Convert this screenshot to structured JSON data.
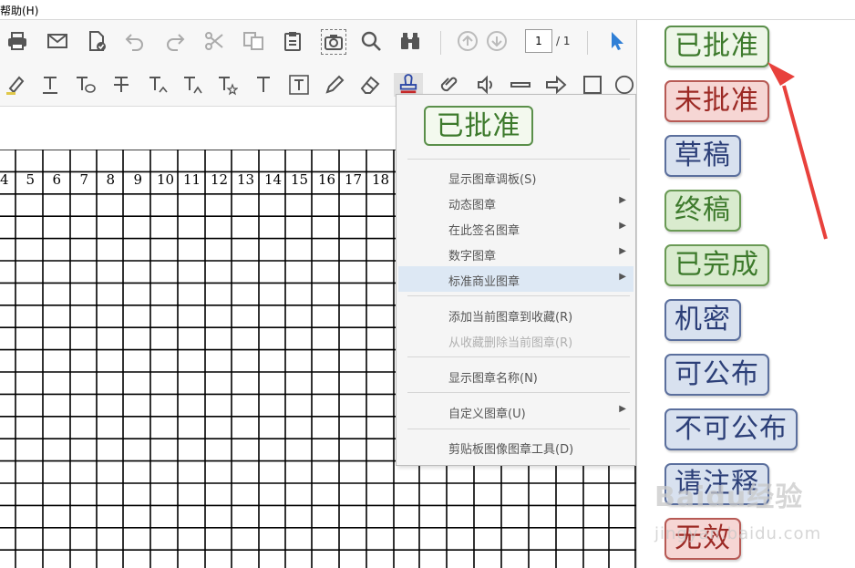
{
  "menubar": {
    "help_label": "帮助(H)"
  },
  "toolbar": {
    "page_current": "1",
    "page_total": "/ 1"
  },
  "grid": {
    "column_numbers": [
      "4",
      "5",
      "6",
      "7",
      "8",
      "9",
      "10",
      "11",
      "12",
      "13",
      "14",
      "15",
      "16",
      "17",
      "18"
    ]
  },
  "stamp_menu": {
    "preview_stamp": "已批准",
    "items": [
      {
        "label": "显示图章调板(S)",
        "submenu": false,
        "disabled": false,
        "highlighted": false
      },
      {
        "label": "动态图章",
        "submenu": true,
        "disabled": false,
        "highlighted": false
      },
      {
        "label": "在此签名图章",
        "submenu": true,
        "disabled": false,
        "highlighted": false
      },
      {
        "label": "数字图章",
        "submenu": true,
        "disabled": false,
        "highlighted": false
      },
      {
        "label": "标准商业图章",
        "submenu": true,
        "disabled": false,
        "highlighted": true
      },
      {
        "label": "添加当前图章到收藏(R)",
        "submenu": false,
        "disabled": false,
        "highlighted": false
      },
      {
        "label": "从收藏删除当前图章(R)",
        "submenu": false,
        "disabled": true,
        "highlighted": false
      },
      {
        "label": "显示图章名称(N)",
        "submenu": false,
        "disabled": false,
        "highlighted": false
      },
      {
        "label": "自定义图章(U)",
        "submenu": true,
        "disabled": false,
        "highlighted": false
      },
      {
        "label": "剪贴板图像图章工具(D)",
        "submenu": false,
        "disabled": false,
        "highlighted": false
      }
    ]
  },
  "standard_stamps": [
    {
      "label": "已批准",
      "color": "green"
    },
    {
      "label": "未批准",
      "color": "red"
    },
    {
      "label": "草稿",
      "color": "blue"
    },
    {
      "label": "终稿",
      "color": "green"
    },
    {
      "label": "已完成",
      "color": "green"
    },
    {
      "label": "机密",
      "color": "blue"
    },
    {
      "label": "可公布",
      "color": "blue"
    },
    {
      "label": "不可公布",
      "color": "blue"
    },
    {
      "label": "请注释",
      "color": "blue"
    },
    {
      "label": "无效",
      "color": "red"
    }
  ],
  "watermark": {
    "text": "Baidu经验",
    "sub": "jingyan.baidu.com"
  },
  "colors": {
    "accent_arrow": "#e8413c",
    "menu_highlight": "#dde8f4"
  }
}
